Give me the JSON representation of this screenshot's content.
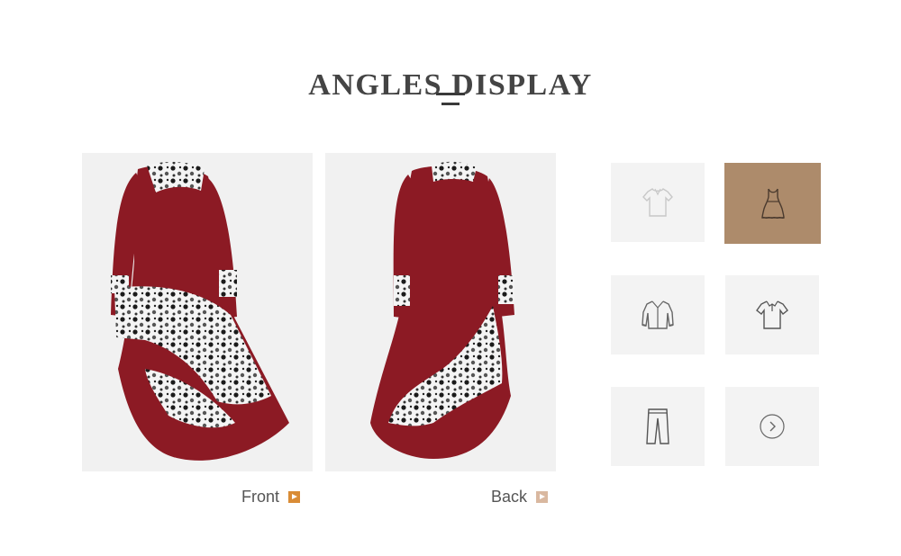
{
  "section": {
    "title": "ANGLES DISPLAY"
  },
  "views": [
    {
      "label": "Front",
      "state": "active"
    },
    {
      "label": "Back",
      "state": "inactive"
    }
  ],
  "categories": [
    {
      "name": "tshirt-icon",
      "selected": false
    },
    {
      "name": "dress-icon",
      "selected": true
    },
    {
      "name": "shirt-icon",
      "selected": false
    },
    {
      "name": "polo-icon",
      "selected": false
    },
    {
      "name": "pants-icon",
      "selected": false
    },
    {
      "name": "next-arrow-icon",
      "selected": false
    }
  ],
  "colors": {
    "accent": "#d98c36",
    "selected_tile": "#ad8b6b",
    "garment": "#8c1a24"
  }
}
